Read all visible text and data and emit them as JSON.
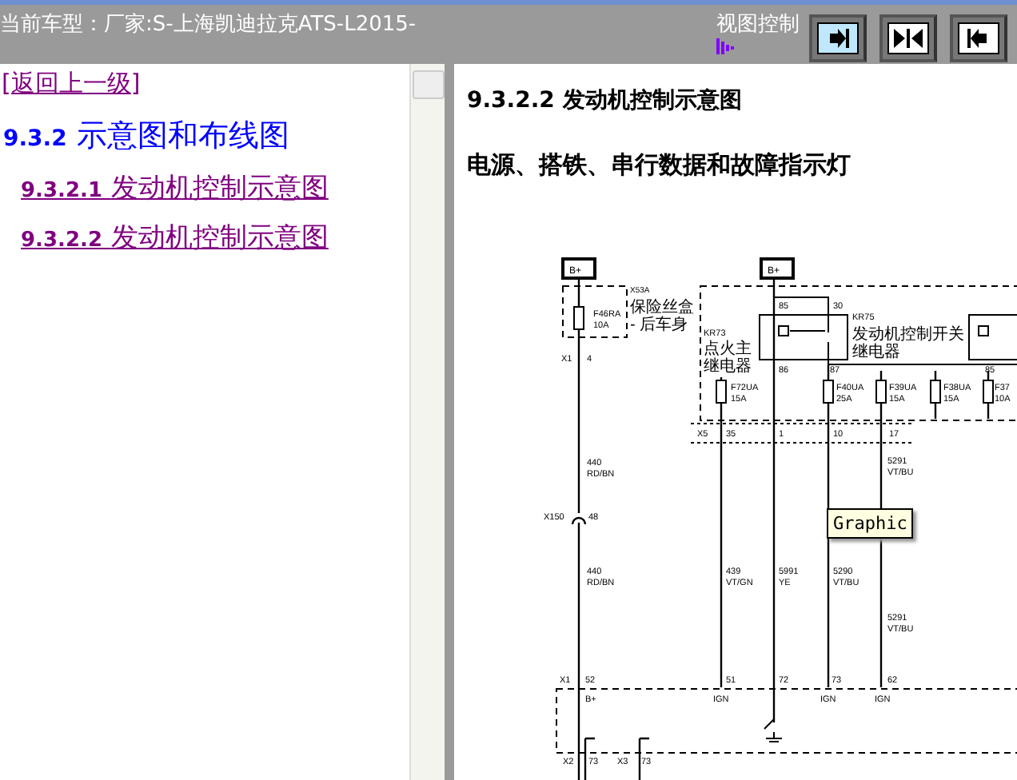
{
  "header": {
    "title": "当前车型：厂家:S-上海凯迪拉克ATS-L2015-",
    "view_control_label": "视图控制",
    "view_buttons": [
      {
        "kind": "right",
        "selected": true
      },
      {
        "kind": "center",
        "selected": false
      },
      {
        "kind": "left",
        "selected": false
      }
    ]
  },
  "sidebar": {
    "back_link": "[返回上一级]",
    "section": {
      "number": "9.3.2",
      "title": "示意图和布线图"
    },
    "items": [
      {
        "number": "9.3.2.1",
        "title": "发动机控制示意图"
      },
      {
        "number": "9.3.2.2",
        "title": "发动机控制示意图"
      }
    ]
  },
  "content": {
    "heading": "9.3.2.2 发动机控制示意图",
    "subheading": "电源、搭铁、串行数据和故障指示灯",
    "diagram_labels": [
      "B+",
      "X53A",
      "保险丝盒",
      "- 后车身",
      "F46RA",
      "10A",
      "X1",
      "4",
      "440",
      "RD/BN",
      "X150",
      "48",
      "440",
      "RD/BN",
      "B+",
      "85",
      "30",
      "KR75",
      "发动机控制开关",
      "继电器",
      "86",
      "87",
      "KR73",
      "点火主",
      "继电器",
      "F72UA",
      "15A",
      "F40UA",
      "25A",
      "F39UA",
      "15A",
      "F38UA",
      "15A",
      "F37",
      "10A",
      "85",
      "X5",
      "35",
      "1",
      "10",
      "17",
      "5291",
      "VT/BU",
      "439",
      "VT/GN",
      "5991",
      "YE",
      "5290",
      "VT/BU",
      "5291",
      "VT/BU",
      "X1",
      "52",
      "51",
      "72",
      "73",
      "62",
      "B+",
      "IGN",
      "IGN",
      "IGN",
      "X2",
      "73",
      "X3",
      "73"
    ],
    "tooltip": "Graphic"
  }
}
